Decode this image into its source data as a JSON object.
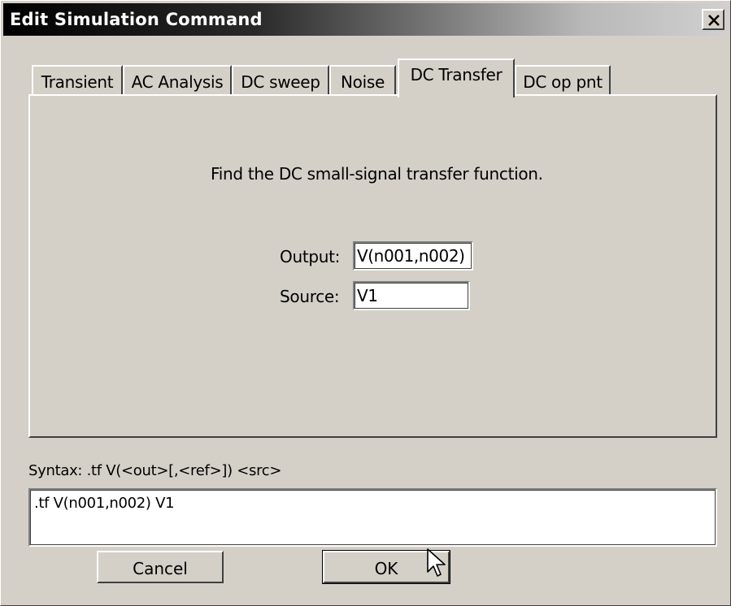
{
  "window": {
    "title": "Edit Simulation Command",
    "close_glyph": "✕"
  },
  "tabs": [
    {
      "label": "Transient",
      "active": false
    },
    {
      "label": "AC Analysis",
      "active": false
    },
    {
      "label": "DC sweep",
      "active": false
    },
    {
      "label": "Noise",
      "active": false
    },
    {
      "label": "DC Transfer",
      "active": true
    },
    {
      "label": "DC op pnt",
      "active": false
    }
  ],
  "panel": {
    "description": "Find the DC small-signal transfer function.",
    "output_label": "Output:",
    "output_value": "V(n001,n002)",
    "source_label": "Source:",
    "source_value": "V1"
  },
  "syntax": {
    "text": "Syntax:  .tf V(<out>[,<ref>]) <src>"
  },
  "command": {
    "value": ".tf V(n001,n002) V1"
  },
  "buttons": {
    "cancel_label": "Cancel",
    "ok_label": "OK"
  },
  "colors": {
    "face": "#d4d0c8",
    "highlight": "#ffffff",
    "shadow": "#404040"
  }
}
